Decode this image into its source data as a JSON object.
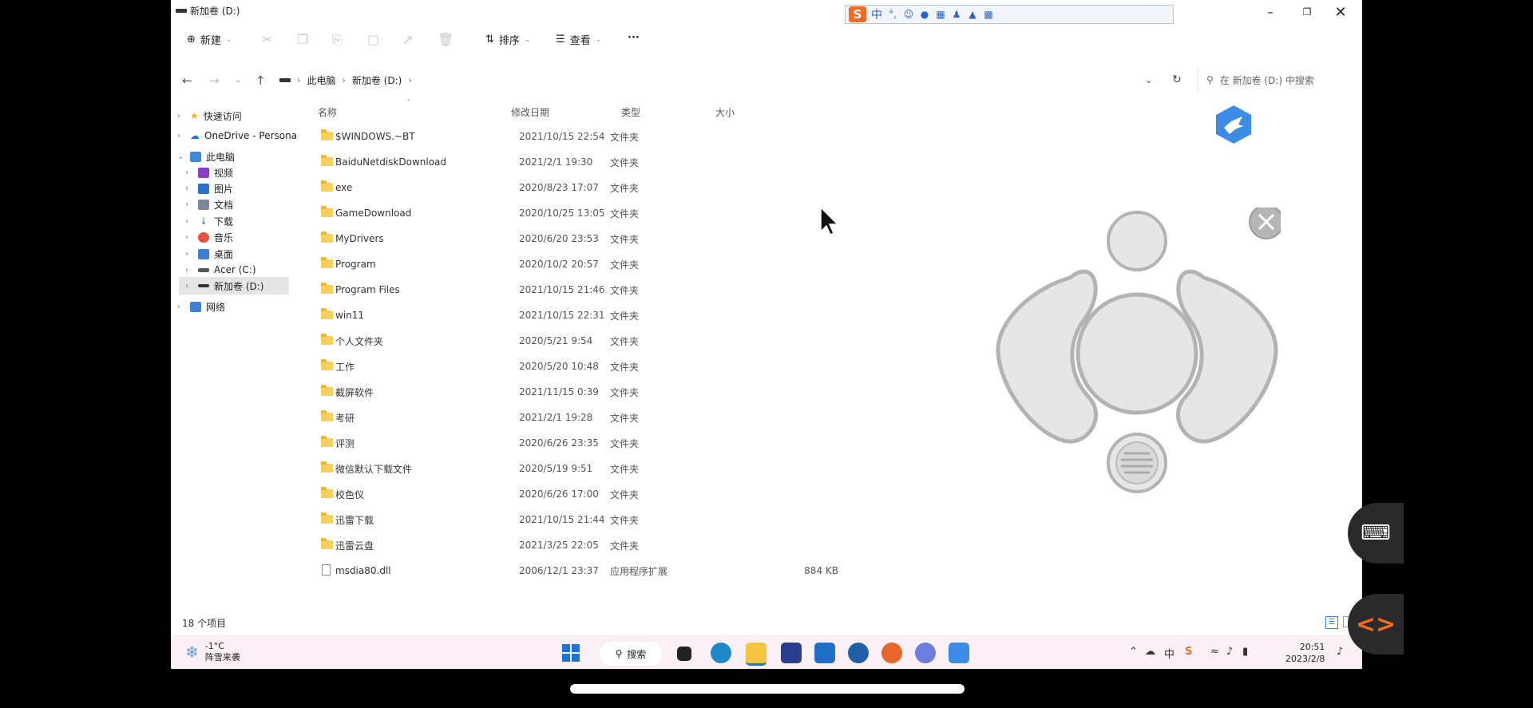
{
  "window": {
    "title": "新加卷 (D:)",
    "minimize_icon": "minimize-icon",
    "maximize_icon": "restore-icon",
    "close_icon": "close-icon"
  },
  "ime_toolbar": {
    "logo": "S",
    "mode": "中"
  },
  "toolbar": {
    "new_label": "新建",
    "sort_label": "排序",
    "view_label": "查看",
    "more_label": "···"
  },
  "address": {
    "crumbs": [
      "此电脑",
      "新加卷 (D:)"
    ],
    "search_placeholder": "在 新加卷 (D:) 中搜索"
  },
  "sidebar": {
    "items": [
      {
        "label": "快速访问",
        "icon": "star-icon",
        "color": "#f2b619"
      },
      {
        "label": "OneDrive - Persona",
        "icon": "cloud-icon",
        "color": "#1f76d2"
      },
      {
        "label": "此电脑",
        "icon": "computer-icon",
        "color": "#3f8ad8"
      },
      {
        "label": "视频",
        "icon": "video-icon",
        "color": "#8b3fc4"
      },
      {
        "label": "图片",
        "icon": "pictures-icon",
        "color": "#2b70c9"
      },
      {
        "label": "文档",
        "icon": "document-icon",
        "color": "#7a8899"
      },
      {
        "label": "下载",
        "icon": "download-icon",
        "color": "#2a9a5b"
      },
      {
        "label": "音乐",
        "icon": "music-icon",
        "color": "#e0533d"
      },
      {
        "label": "桌面",
        "icon": "desktop-icon",
        "color": "#3c7fd4"
      },
      {
        "label": "Acer (C:)",
        "icon": "drive-icon",
        "color": "#555555"
      },
      {
        "label": "新加卷 (D:)",
        "icon": "drive-icon",
        "color": "#333333"
      },
      {
        "label": "网络",
        "icon": "network-icon",
        "color": "#3c7fd4"
      }
    ]
  },
  "columns": {
    "name": "名称",
    "date": "修改日期",
    "type": "类型",
    "size": "大小"
  },
  "files": [
    {
      "name": "$WINDOWS.~BT",
      "date": "2021/10/15 22:54",
      "type": "文件夹",
      "size": ""
    },
    {
      "name": "BaiduNetdiskDownload",
      "date": "2021/2/1 19:30",
      "type": "文件夹",
      "size": ""
    },
    {
      "name": "exe",
      "date": "2020/8/23 17:07",
      "type": "文件夹",
      "size": ""
    },
    {
      "name": "GameDownload",
      "date": "2020/10/25 13:05",
      "type": "文件夹",
      "size": ""
    },
    {
      "name": "MyDrivers",
      "date": "2020/6/20 23:53",
      "type": "文件夹",
      "size": ""
    },
    {
      "name": "Program",
      "date": "2020/10/2 20:57",
      "type": "文件夹",
      "size": ""
    },
    {
      "name": "Program Files",
      "date": "2021/10/15 21:46",
      "type": "文件夹",
      "size": ""
    },
    {
      "name": "win11",
      "date": "2021/10/15 22:31",
      "type": "文件夹",
      "size": ""
    },
    {
      "name": "个人文件夹",
      "date": "2020/5/21 9:54",
      "type": "文件夹",
      "size": ""
    },
    {
      "name": "工作",
      "date": "2020/5/20 10:48",
      "type": "文件夹",
      "size": ""
    },
    {
      "name": "截屏软件",
      "date": "2021/11/15 0:39",
      "type": "文件夹",
      "size": ""
    },
    {
      "name": "考研",
      "date": "2021/2/1 19:28",
      "type": "文件夹",
      "size": ""
    },
    {
      "name": "评测",
      "date": "2020/6/26 23:35",
      "type": "文件夹",
      "size": ""
    },
    {
      "name": "微信默认下载文件",
      "date": "2020/5/19 9:51",
      "type": "文件夹",
      "size": ""
    },
    {
      "name": "校色仪",
      "date": "2020/6/26 17:00",
      "type": "文件夹",
      "size": ""
    },
    {
      "name": "迅雷下载",
      "date": "2021/10/15 21:44",
      "type": "文件夹",
      "size": ""
    },
    {
      "name": "迅雷云盘",
      "date": "2021/3/25 22:05",
      "type": "文件夹",
      "size": ""
    },
    {
      "name": "msdia80.dll",
      "date": "2006/12/1 23:37",
      "type": "应用程序扩展",
      "size": "884 KB"
    }
  ],
  "status": {
    "count": "18 个项目"
  },
  "taskbar": {
    "weather_temp": "-1°C",
    "weather_desc": "阵雪来袭",
    "search_label": "搜索",
    "tray_lang": "中",
    "time": "20:51",
    "date": "2023/2/8"
  }
}
